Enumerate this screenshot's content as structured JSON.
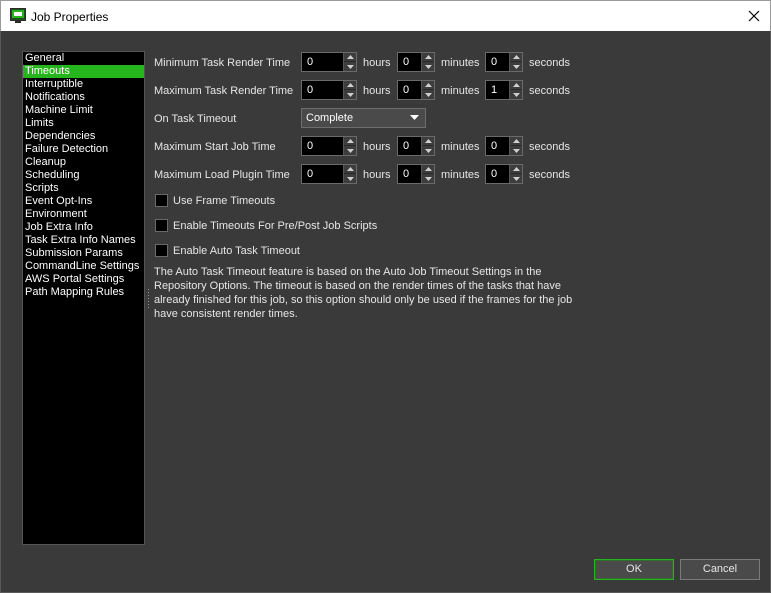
{
  "window": {
    "title": "Job Properties",
    "icon": "monitor-app-icon",
    "close_icon": "close-icon"
  },
  "sidebar": {
    "selected_index": 1,
    "items": [
      {
        "label": "General"
      },
      {
        "label": "Timeouts"
      },
      {
        "label": "Interruptible"
      },
      {
        "label": "Notifications"
      },
      {
        "label": "Machine Limit"
      },
      {
        "label": "Limits"
      },
      {
        "label": "Dependencies"
      },
      {
        "label": "Failure Detection"
      },
      {
        "label": "Cleanup"
      },
      {
        "label": "Scheduling"
      },
      {
        "label": "Scripts"
      },
      {
        "label": "Event Opt-Ins"
      },
      {
        "label": "Environment"
      },
      {
        "label": "Job Extra Info"
      },
      {
        "label": "Task Extra Info Names"
      },
      {
        "label": "Submission Params"
      },
      {
        "label": "CommandLine Settings"
      },
      {
        "label": "AWS Portal Settings"
      },
      {
        "label": "Path Mapping Rules"
      }
    ]
  },
  "units": {
    "hours": "hours",
    "minutes": "minutes",
    "seconds": "seconds"
  },
  "timeouts": {
    "min_task_render": {
      "label": "Minimum Task Render Time",
      "hours": "0",
      "minutes": "0",
      "seconds": "0"
    },
    "max_task_render": {
      "label": "Maximum Task Render Time",
      "hours": "0",
      "minutes": "0",
      "seconds": "1"
    },
    "on_task_timeout": {
      "label": "On Task Timeout",
      "value": "Complete"
    },
    "max_start_job": {
      "label": "Maximum Start Job Time",
      "hours": "0",
      "minutes": "0",
      "seconds": "0"
    },
    "max_load_plugin": {
      "label": "Maximum Load Plugin Time",
      "hours": "0",
      "minutes": "0",
      "seconds": "0"
    }
  },
  "checkboxes": {
    "use_frame_timeouts": {
      "label": "Use Frame Timeouts",
      "checked": false
    },
    "enable_pre_post": {
      "label": "Enable Timeouts For Pre/Post Job Scripts",
      "checked": false
    },
    "enable_auto_task": {
      "label": "Enable Auto Task Timeout",
      "checked": false
    }
  },
  "description": "The Auto Task Timeout feature is based on the Auto Job Timeout Settings in the Repository Options. The timeout is based on the render times of the tasks that have already finished for this job, so this option should only be used if the frames for the job have consistent render times.",
  "buttons": {
    "ok": "OK",
    "cancel": "Cancel"
  },
  "colors": {
    "accent": "#27b51d",
    "background": "#3a3a3a",
    "list_background": "#000000"
  }
}
